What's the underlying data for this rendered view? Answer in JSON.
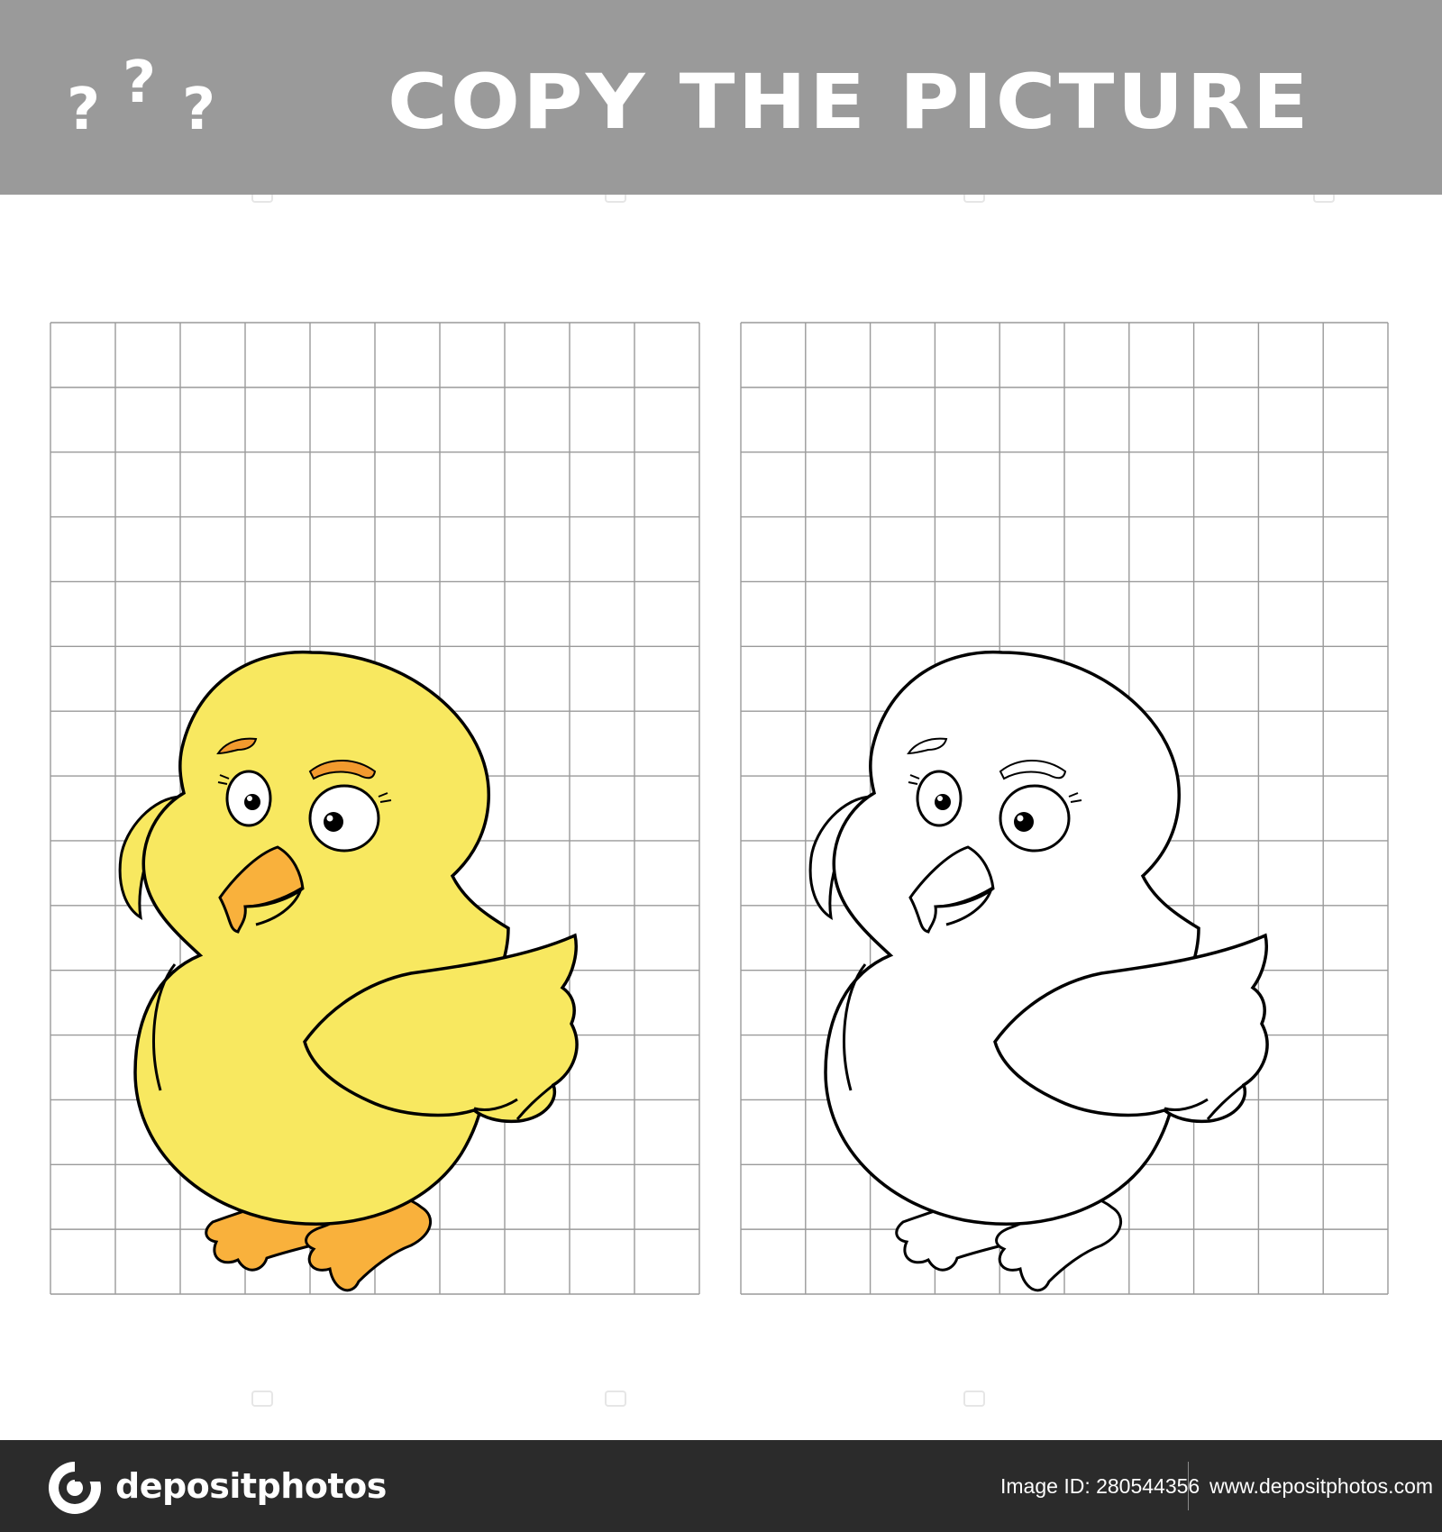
{
  "header": {
    "question_marks": [
      "?",
      "?",
      "?"
    ],
    "title": "COPY THE PICTURE",
    "background": "#9a9a9a"
  },
  "worksheet": {
    "grids": [
      {
        "name": "model-grid",
        "columns": 10,
        "rows": 15,
        "line_color": "#9a9a9a"
      },
      {
        "name": "practice-grid",
        "columns": 10,
        "rows": 15,
        "line_color": "#9a9a9a"
      }
    ],
    "model_chick": {
      "fill": "#f8e860",
      "feet_beak": "#f9b13c",
      "brows": "#f29a2e",
      "outline": "#000000"
    },
    "practice_chick": {
      "fill": "#ffffff",
      "outline": "#000000"
    },
    "watermark": "depositphotos"
  },
  "footer": {
    "brand": "depositphotos",
    "image_id": "Image ID: 280544356",
    "site": "www.depositphotos.com",
    "background": "#2b2b2b"
  }
}
